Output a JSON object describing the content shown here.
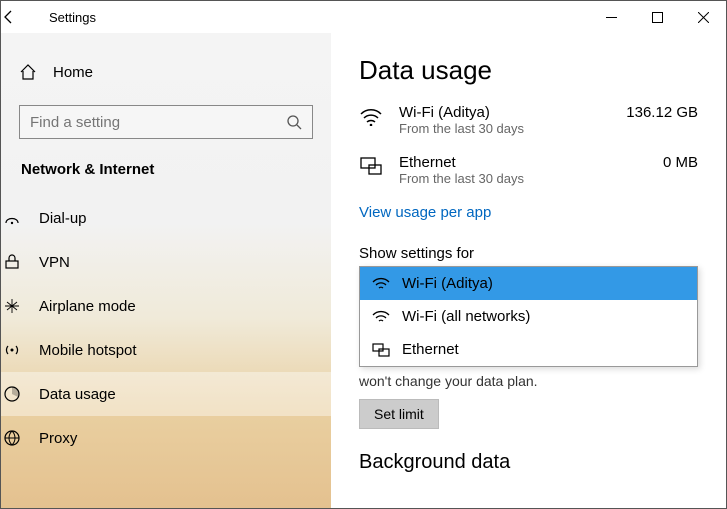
{
  "window": {
    "title": "Settings"
  },
  "sidebar": {
    "home": "Home",
    "search_placeholder": "Find a setting",
    "section": "Network & Internet",
    "items": [
      {
        "label": "Dial-up"
      },
      {
        "label": "VPN"
      },
      {
        "label": "Airplane mode"
      },
      {
        "label": "Mobile hotspot"
      },
      {
        "label": "Data usage"
      },
      {
        "label": "Proxy"
      }
    ]
  },
  "main": {
    "heading": "Data usage",
    "usage": [
      {
        "name": "Wi-Fi (Aditya)",
        "sub": "From the last 30 days",
        "value": "136.12 GB"
      },
      {
        "name": "Ethernet",
        "sub": "From the last 30 days",
        "value": "0 MB"
      }
    ],
    "link": "View usage per app",
    "show_settings_label": "Show settings for",
    "dropdown": [
      "Wi-Fi (Aditya)",
      "Wi-Fi (all networks)",
      "Ethernet"
    ],
    "hint": "won't change your data plan.",
    "set_limit": "Set limit",
    "bg_heading": "Background data"
  }
}
